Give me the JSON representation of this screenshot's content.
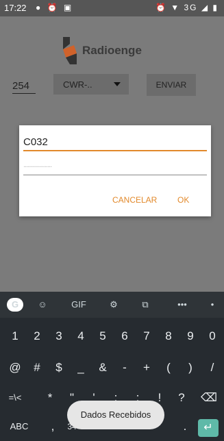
{
  "status": {
    "time": "17:22",
    "left_icons": "● ⏰ ▣",
    "right_icons": "⏰ ▼ 3G ◢ ▮"
  },
  "app": {
    "brand": "Radioenge",
    "number_value": "254",
    "spinner_value": "CWR-..",
    "send_label": "ENVIAR"
  },
  "dialog": {
    "field1_value": "C032",
    "field2_placeholder": "....................",
    "cancel_label": "CANCELAR",
    "ok_label": "OK"
  },
  "keyboard": {
    "suggestion_icons": {
      "g": "G",
      "emoji": "☺",
      "gif": "GIF",
      "settings": "⚙",
      "translate": "⧉",
      "more": "•••",
      "mic": "•"
    },
    "row_numbers": [
      "1",
      "2",
      "3",
      "4",
      "5",
      "6",
      "7",
      "8",
      "9",
      "0"
    ],
    "row_symbols": [
      "@",
      "#",
      "$",
      "_",
      "&",
      "-",
      "+",
      "(",
      ")",
      "/"
    ],
    "row_symbols2": [
      "=\\<",
      "*",
      "\"",
      "'",
      ":",
      ";",
      "!",
      "?",
      "⌫"
    ],
    "row_bottom": {
      "abc": "ABC",
      "comma": ",",
      "nums": "34",
      "period": ".",
      "enter": "↵"
    }
  },
  "toast": {
    "text": "Dados Recebidos"
  }
}
